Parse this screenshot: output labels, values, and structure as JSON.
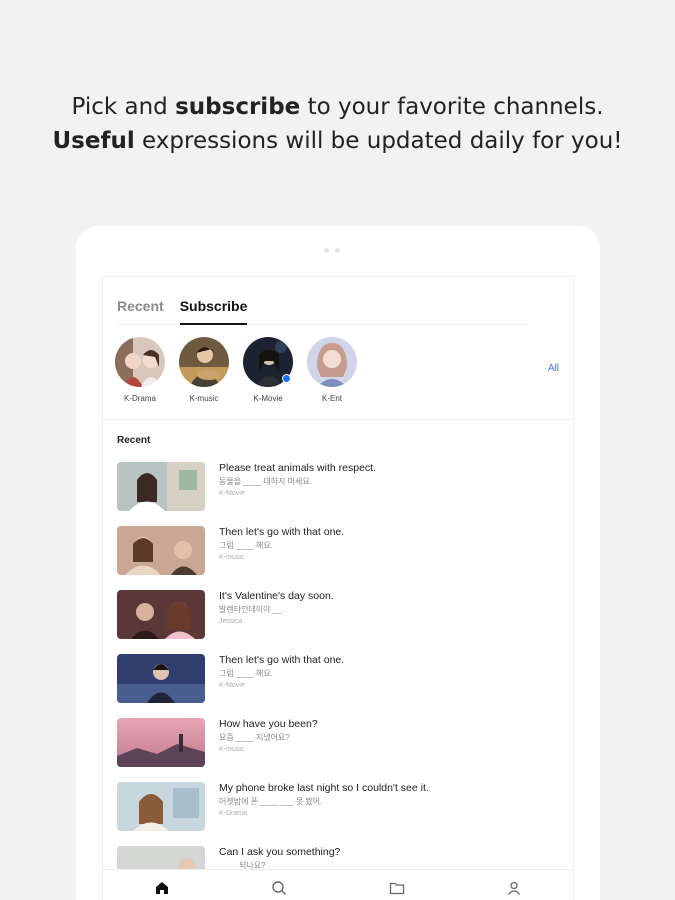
{
  "headline": {
    "part1": "Pick and ",
    "bold1": "subscribe",
    "part2": " to your favorite channels. ",
    "bold2": "Useful",
    "part3": " expressions will be updated daily for you!"
  },
  "tabs": [
    {
      "label": "Recent",
      "active": false
    },
    {
      "label": "Subscribe",
      "active": true
    }
  ],
  "channels": [
    {
      "label": "K-Drama",
      "icon": "kdrama-avatar",
      "has_dot": false
    },
    {
      "label": "K-music",
      "icon": "kmusic-avatar",
      "has_dot": false
    },
    {
      "label": "K-Movie",
      "icon": "kmovie-avatar",
      "has_dot": true
    },
    {
      "label": "K-Ent",
      "icon": "kent-avatar",
      "has_dot": false
    }
  ],
  "all_label": "All",
  "recent_title": "Recent",
  "items": [
    {
      "english": "Please treat animals with respect.",
      "korean": "동물을 ____ 대하지 마세요.",
      "source": "K-Movie"
    },
    {
      "english": "Then let's go with that one.",
      "korean": "그럼 ____ 해요.",
      "source": "K-music"
    },
    {
      "english": "It's Valentine's day soon.",
      "korean": "발렌타인데이야 __.",
      "source": "Jessica"
    },
    {
      "english": "Then let's go with that one.",
      "korean": "그럼 ____ 해요.",
      "source": "K-Movie"
    },
    {
      "english": "How have you been?",
      "korean": "요즘 ____ 지냈어요?",
      "source": "K-music"
    },
    {
      "english": "My phone broke last night so I couldn't see it.",
      "korean": "어젯밤에 폰 ____ ___ 못 봤어.",
      "source": "K-Drama"
    },
    {
      "english": "Can I ask you something?",
      "korean": "____ 되나요?",
      "source": ""
    }
  ],
  "nav": [
    "home-icon",
    "search-icon",
    "folder-icon",
    "profile-icon"
  ],
  "colors": {
    "accent": "#3b7ce6",
    "dot": "#1e6ff5"
  }
}
